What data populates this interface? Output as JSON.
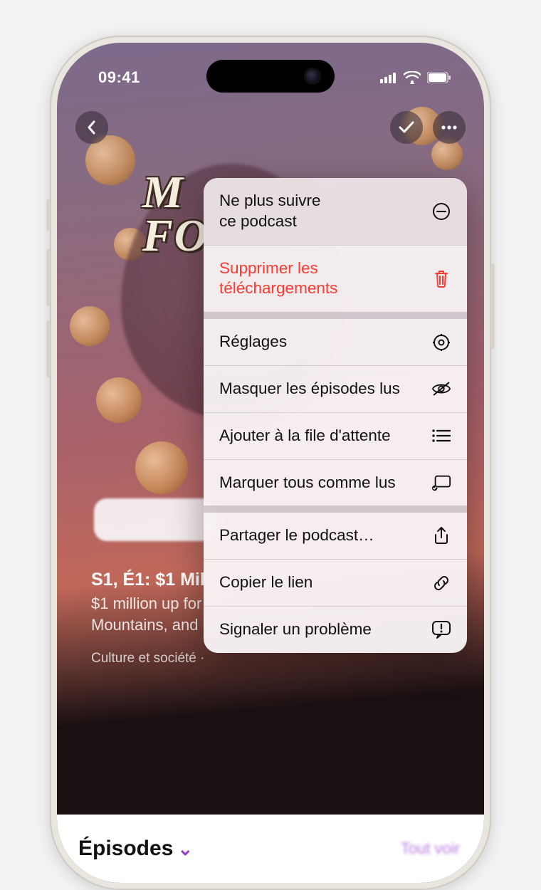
{
  "status": {
    "time": "09:41"
  },
  "artwork": {
    "title_line1": "M",
    "title_line2": "FO"
  },
  "episode": {
    "title": "S1, É1: $1 Million",
    "description": "$1 million up for g\nMountains, and n",
    "category": "Culture et société ·"
  },
  "bottom": {
    "heading": "Épisodes",
    "see_all": "Tout voir"
  },
  "menu": {
    "unfollow": "Ne plus suivre\nce podcast",
    "delete_downloads": "Supprimer les téléchargements",
    "settings": "Réglages",
    "hide_played": "Masquer les épisodes lus",
    "add_queue": "Ajouter à la file d'attente",
    "mark_all_played": "Marquer tous comme lus",
    "share_podcast": "Partager le podcast…",
    "copy_link": "Copier le lien",
    "report": "Signaler un problème"
  }
}
